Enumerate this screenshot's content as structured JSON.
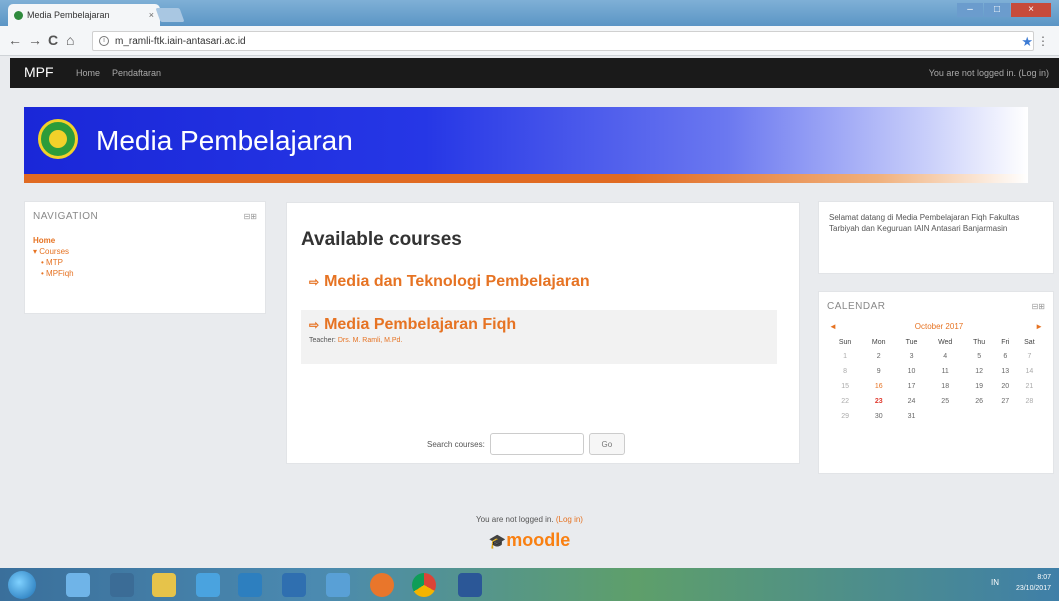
{
  "browser": {
    "tab_title": "Media Pembelajaran",
    "tab_close": "×",
    "url": "m_ramli-ftk.iain-antasari.ac.id",
    "back": "←",
    "forward": "→",
    "reload": "C",
    "home": "⌂",
    "star": "★",
    "menu": "⋮",
    "window_controls": {
      "minimize": "–",
      "maximize": "□",
      "close": "×"
    }
  },
  "navbar": {
    "brand": "MPF",
    "items": [
      "Home",
      "Pendaftaran"
    ],
    "login_text": "You are not logged in. (Log in)"
  },
  "header": {
    "site_name": "Media Pembelajaran"
  },
  "navigation_block": {
    "title": "NAVIGATION",
    "controls": "⊟⊞",
    "items": {
      "home": "Home",
      "courses": "▾ Courses",
      "course1": "• MTP",
      "course2": "• MPFiqh"
    }
  },
  "main": {
    "heading": "Available courses",
    "courses": [
      {
        "name": "Media dan Teknologi Pembelajaran",
        "icon": "⇨"
      },
      {
        "name": "Media Pembelajaran Fiqh",
        "icon": "⇨",
        "teacher_label": "Teacher:",
        "teacher_name": "Drs. M. Ramli, M.Pd."
      }
    ],
    "search": {
      "label": "Search courses:",
      "placeholder": "",
      "button": "Go"
    }
  },
  "welcome_block": {
    "text": "Selamat datang di Media Pembelajaran Fiqh Fakultas Tarbiyah dan Keguruan IAIN Antasari Banjarmasin"
  },
  "calendar": {
    "title": "CALENDAR",
    "controls": "⊟⊞",
    "prev": "◄",
    "next": "►",
    "month": "October 2017",
    "days": [
      "Sun",
      "Mon",
      "Tue",
      "Wed",
      "Thu",
      "Fri",
      "Sat"
    ],
    "weeks": [
      [
        "1",
        "2",
        "3",
        "4",
        "5",
        "6",
        "7"
      ],
      [
        "8",
        "9",
        "10",
        "11",
        "12",
        "13",
        "14"
      ],
      [
        "15",
        "16",
        "17",
        "18",
        "19",
        "20",
        "21"
      ],
      [
        "22",
        "23",
        "24",
        "25",
        "26",
        "27",
        "28"
      ],
      [
        "29",
        "30",
        "31",
        "",
        "",
        "",
        ""
      ]
    ],
    "today": "23",
    "event_day": "16"
  },
  "footer": {
    "login_prefix": "You are not logged in.",
    "login_link": "(Log in)",
    "logo_text": "moodle",
    "logo_hat": "🎓"
  },
  "taskbar": {
    "tray_text": "IN",
    "time": "8:07",
    "date": "23/10/2017"
  }
}
